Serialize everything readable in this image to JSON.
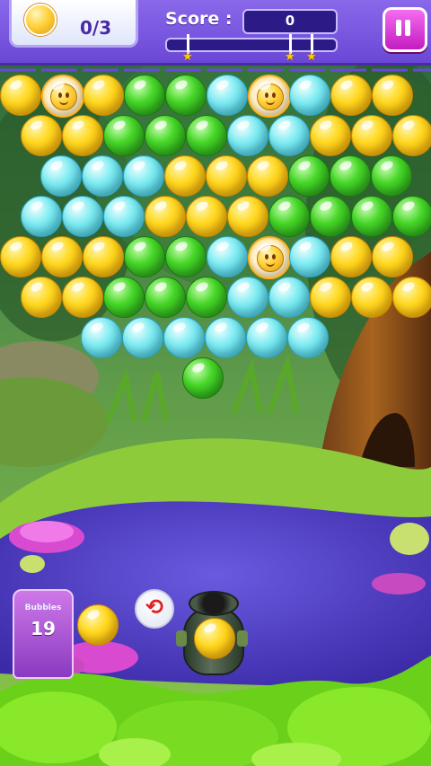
{
  "hud": {
    "targets_collected": "0/3",
    "score_label": "Score :",
    "score_value": "0",
    "star_count": 3,
    "pause_icon": "pause-icon"
  },
  "board": {
    "rows": [
      [
        "yellow",
        "target",
        "yellow",
        "green",
        "green",
        "cyan",
        "target",
        "cyan",
        "yellow",
        "yellow"
      ],
      [
        "yellow",
        "yellow",
        "green",
        "green",
        "green",
        "cyan",
        "cyan",
        "yellow",
        "yellow",
        "yellow"
      ],
      [
        "cyan",
        "cyan",
        "cyan",
        "yellow",
        "yellow",
        "yellow",
        "green",
        "green",
        "green"
      ],
      [
        "cyan",
        "cyan",
        "cyan",
        "yellow",
        "yellow",
        "yellow",
        "green",
        "green",
        "green",
        "green"
      ],
      [
        "yellow",
        "yellow",
        "yellow",
        "green",
        "green",
        "cyan",
        "target",
        "cyan",
        "yellow",
        "yellow"
      ],
      [
        "yellow",
        "yellow",
        "green",
        "green",
        "green",
        "cyan",
        "cyan",
        "yellow",
        "yellow",
        "yellow"
      ],
      [
        "cyan",
        "cyan",
        "cyan",
        "cyan",
        "cyan",
        "cyan"
      ],
      [
        "green"
      ]
    ]
  },
  "bottom": {
    "bubbles_label": "Bubbles",
    "bubbles_left": "19",
    "next_bubble_color": "yellow",
    "loaded_bubble_color": "yellow",
    "swap_icon": "swap-icon"
  }
}
